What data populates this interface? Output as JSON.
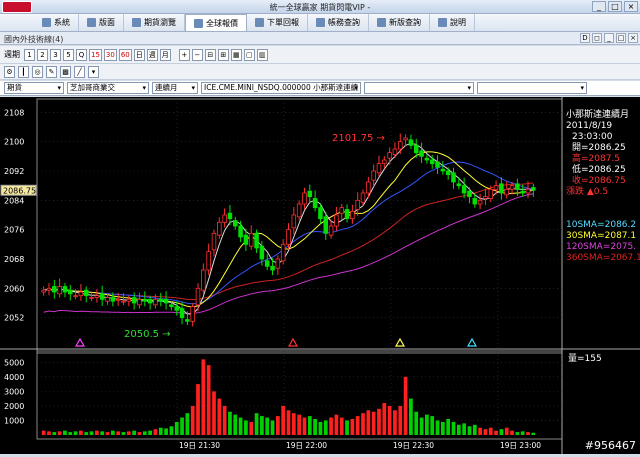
{
  "window": {
    "title": "統一全球贏家 期貨閃電VIP -",
    "min": "_",
    "max": "□",
    "close": "×"
  },
  "menu": [
    {
      "label": "系統"
    },
    {
      "label": "版面"
    },
    {
      "label": "期貨瀏覽"
    },
    {
      "label": "全球報價"
    },
    {
      "label": "下單回報"
    },
    {
      "label": "帳務查詢"
    },
    {
      "label": "新版查詢"
    },
    {
      "label": "說明"
    }
  ],
  "panel": {
    "title": "國內外技術線(4)"
  },
  "toolbar": {
    "label": "週期",
    "buttons": [
      "1",
      "2",
      "3",
      "5",
      "Q",
      "15",
      "30",
      "60",
      "日",
      "週",
      "月"
    ]
  },
  "selectors": {
    "category": "期貨",
    "exchange": "芝加哥商業交",
    "contract": "連續月",
    "symbol": "ICE.CME.MINI_NSDQ.000000 小那斯達連續",
    "extra": ""
  },
  "chart_data": {
    "type": "candlestick",
    "price_axis": {
      "ylim": [
        2044,
        2110
      ],
      "ticks": [
        2108,
        2100,
        2092,
        2084,
        2076,
        2068,
        2060,
        2052
      ]
    },
    "current_price_tag": "2086.75",
    "time_ticks": [
      "19日 21:30",
      "19日 22:00",
      "19日 22:30",
      "19日 23:00"
    ],
    "annotations": [
      {
        "text": "2101.75 →",
        "color": "#ff3333"
      },
      {
        "text": "2050.5 →",
        "color": "#33dd33"
      }
    ],
    "info": {
      "symbol": "小那斯達連續月",
      "date": "2011/8/19",
      "time": "23:03:00",
      "open": "開=2086.25",
      "high": "高=2087.5",
      "low": "低=2086.25",
      "close": "收=2086.75",
      "change": "▲0.5",
      "change_label": "漲跌",
      "sma10": "10SMA=2086.2",
      "sma30": "30SMA=2087.1",
      "sma120": "120SMA=2075.",
      "sma360": "360SMA=2067.1"
    },
    "volume_axis": {
      "ylim": [
        0,
        5500
      ],
      "ticks": [
        5000,
        4000,
        3000,
        2000,
        1000
      ]
    },
    "volume_label": "量=155",
    "series": {
      "close": [
        2059.5,
        2060,
        2059,
        2060.5,
        2059,
        2058.5,
        2058,
        2059,
        2058,
        2057.5,
        2058,
        2057,
        2057.5,
        2056.5,
        2057,
        2056.5,
        2057,
        2056,
        2057,
        2056.5,
        2056,
        2057,
        2056.5,
        2056,
        2055,
        2054,
        2052,
        2051,
        2055,
        2060,
        2065,
        2070,
        2075,
        2078,
        2080,
        2079,
        2077,
        2074,
        2072,
        2075,
        2071,
        2068,
        2066,
        2065,
        2068,
        2072,
        2076,
        2080,
        2083,
        2086,
        2085,
        2082,
        2079,
        2075,
        2077,
        2080,
        2082,
        2079,
        2081,
        2084,
        2086,
        2089,
        2092,
        2094,
        2095,
        2097,
        2098,
        2100,
        2101,
        2099,
        2097,
        2096,
        2095,
        2094,
        2093,
        2092,
        2091,
        2089,
        2088,
        2086,
        2085,
        2083,
        2084,
        2085,
        2087,
        2088,
        2086,
        2087,
        2088,
        2087,
        2086,
        2087,
        2086.75
      ],
      "volume": [
        300,
        250,
        200,
        250,
        300,
        200,
        250,
        300,
        200,
        250,
        300,
        250,
        200,
        300,
        250,
        200,
        250,
        300,
        200,
        250,
        300,
        400,
        500,
        450,
        600,
        900,
        1200,
        1500,
        2000,
        3500,
        5200,
        4800,
        3000,
        2500,
        2000,
        1600,
        1400,
        1200,
        1000,
        900,
        1500,
        1300,
        1200,
        1000,
        1300,
        2000,
        1700,
        1500,
        1400,
        1200,
        1300,
        1100,
        900,
        1000,
        1200,
        1400,
        1200,
        1000,
        1100,
        1300,
        1500,
        1700,
        1600,
        1800,
        2200,
        2000,
        1700,
        2000,
        4000,
        2500,
        1600,
        1200,
        1400,
        1300,
        1000,
        900,
        1100,
        900,
        700,
        800,
        600,
        700,
        500,
        400,
        500,
        300,
        400,
        500,
        300,
        200,
        250,
        200,
        155
      ]
    }
  },
  "watermark": "#956467"
}
